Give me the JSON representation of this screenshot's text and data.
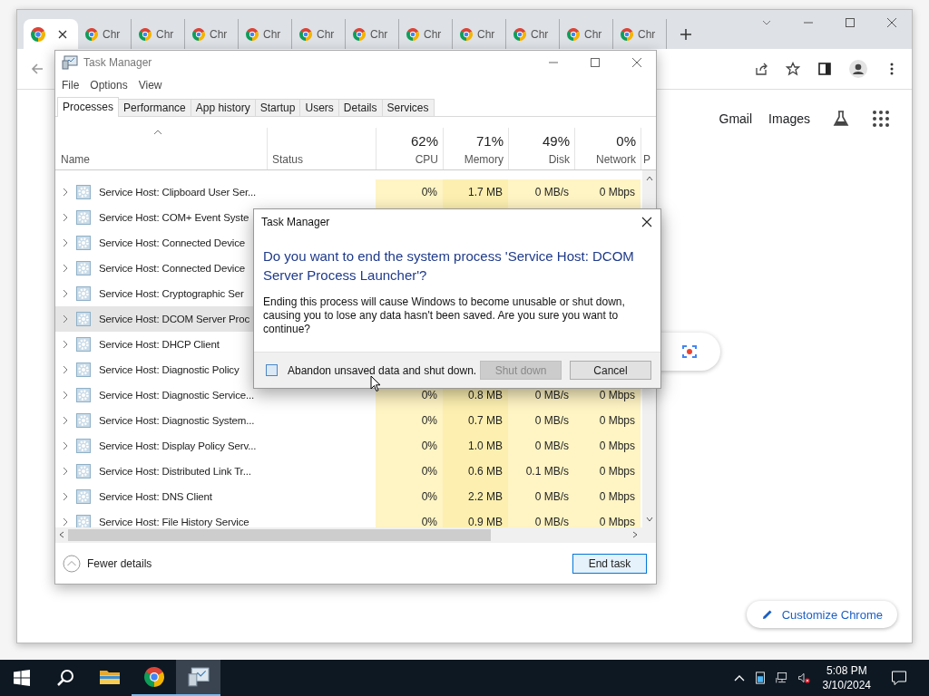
{
  "browser": {
    "tabs": [
      {
        "selected": true
      },
      {
        "label": "Chr",
        "selected": false
      },
      {
        "label": "Chr",
        "selected": false
      },
      {
        "label": "Chr",
        "selected": false
      },
      {
        "label": "Chr",
        "selected": false
      },
      {
        "label": "Chr",
        "selected": false
      },
      {
        "label": "Chr",
        "selected": false
      },
      {
        "label": "Chr",
        "selected": false
      },
      {
        "label": "Chr",
        "selected": false
      },
      {
        "label": "Chr",
        "selected": false
      },
      {
        "label": "Chr",
        "selected": false
      },
      {
        "label": "Chr",
        "selected": false
      }
    ],
    "links": [
      "Gmail",
      "Images"
    ],
    "customize_button": "Customize Chrome"
  },
  "task_manager": {
    "title": "Task Manager",
    "menu": [
      "File",
      "Options",
      "View"
    ],
    "tabs": [
      {
        "label": "Processes",
        "selected": true
      },
      {
        "label": "Performance",
        "selected": false
      },
      {
        "label": "App history",
        "selected": false
      },
      {
        "label": "Startup",
        "selected": false
      },
      {
        "label": "Users",
        "selected": false
      },
      {
        "label": "Details",
        "selected": false
      },
      {
        "label": "Services",
        "selected": false
      }
    ],
    "columns": [
      {
        "label": "Name",
        "kind": "name",
        "sorted": true
      },
      {
        "label": "Status",
        "kind": "text"
      },
      {
        "label": "CPU",
        "kind": "usage",
        "usage": "62%"
      },
      {
        "label": "Memory",
        "kind": "usage",
        "usage": "71%"
      },
      {
        "label": "Disk",
        "kind": "usage",
        "usage": "49%"
      },
      {
        "label": "Network",
        "kind": "usage",
        "usage": "0%"
      },
      {
        "label": "P",
        "kind": "cut"
      }
    ],
    "rows": [
      {
        "name": "Service Host: Clipboard User Ser...",
        "selected": false,
        "cpu": "0%",
        "memory": "1.7 MB",
        "disk": "0 MB/s",
        "network": "0 Mbps"
      },
      {
        "name": "Service Host: COM+ Event Syste",
        "selected": false
      },
      {
        "name": "Service Host: Connected Device",
        "selected": false
      },
      {
        "name": "Service Host: Connected Device",
        "selected": false
      },
      {
        "name": "Service Host: Cryptographic Ser",
        "selected": false
      },
      {
        "name": "Service Host: DCOM Server Proc",
        "selected": true
      },
      {
        "name": "Service Host: DHCP Client",
        "selected": false
      },
      {
        "name": "Service Host: Diagnostic Policy",
        "selected": false
      },
      {
        "name": "Service Host: Diagnostic Service...",
        "selected": false,
        "cpu": "0%",
        "memory": "0.8 MB",
        "disk": "0 MB/s",
        "network": "0 Mbps"
      },
      {
        "name": "Service Host: Diagnostic System...",
        "selected": false,
        "cpu": "0%",
        "memory": "0.7 MB",
        "disk": "0 MB/s",
        "network": "0 Mbps"
      },
      {
        "name": "Service Host: Display Policy Serv...",
        "selected": false,
        "cpu": "0%",
        "memory": "1.0 MB",
        "disk": "0 MB/s",
        "network": "0 Mbps"
      },
      {
        "name": "Service Host: Distributed Link Tr...",
        "selected": false,
        "cpu": "0%",
        "memory": "0.6 MB",
        "disk": "0.1 MB/s",
        "network": "0 Mbps"
      },
      {
        "name": "Service Host: DNS Client",
        "selected": false,
        "cpu": "0%",
        "memory": "2.2 MB",
        "disk": "0 MB/s",
        "network": "0 Mbps"
      },
      {
        "name": "Service Host: File History Service",
        "selected": false,
        "cpu": "0%",
        "memory": "0.9 MB",
        "disk": "0 MB/s",
        "network": "0 Mbps"
      }
    ],
    "fewer_details": "Fewer details",
    "end_task": "End task"
  },
  "dialog": {
    "title": "Task Manager",
    "heading": "Do you want to end the system process 'Service Host: DCOM Server Process Launcher'?",
    "message": "Ending this process will cause Windows to become unusable or shut down, causing you to lose any data hasn't been saved. Are you sure you want to continue?",
    "checkbox": {
      "label": "Abandon unsaved data and shut down.",
      "checked": false
    },
    "buttons": [
      {
        "label": "Shut down",
        "disabled": true
      },
      {
        "label": "Cancel",
        "disabled": false
      }
    ]
  },
  "taskbar": {
    "apps": [
      {
        "kind": "explorer",
        "running": false,
        "selected": false
      },
      {
        "kind": "chrome",
        "running": true,
        "selected": false
      },
      {
        "kind": "taskmgr",
        "running": true,
        "selected": true
      }
    ],
    "time": "5:08 PM",
    "date": "3/10/2024"
  }
}
